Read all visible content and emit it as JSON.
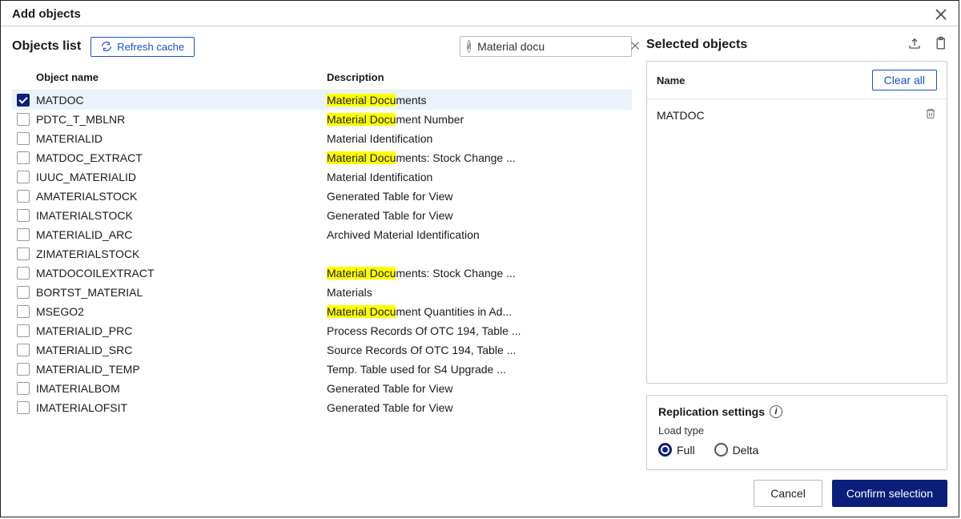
{
  "dialog": {
    "title": "Add objects"
  },
  "left": {
    "heading": "Objects list",
    "refresh_label": "Refresh cache",
    "search_value": "Material docu",
    "columns": {
      "object": "Object name",
      "description": "Description"
    },
    "highlight_prefix": "Material Docu",
    "rows": [
      {
        "name": "MATDOC",
        "checked": true,
        "desc_prefix": "Material Docu",
        "desc_rest": "ments"
      },
      {
        "name": "PDTC_T_MBLNR",
        "checked": false,
        "desc_prefix": "Material Docu",
        "desc_rest": "ment Number"
      },
      {
        "name": "MATERIALID",
        "checked": false,
        "desc_prefix": "",
        "desc_rest": "Material Identification"
      },
      {
        "name": "MATDOC_EXTRACT",
        "checked": false,
        "desc_prefix": "Material Docu",
        "desc_rest": "ments: Stock Change ..."
      },
      {
        "name": "IUUC_MATERIALID",
        "checked": false,
        "desc_prefix": "",
        "desc_rest": "Material Identification"
      },
      {
        "name": "AMATERIALSTOCK",
        "checked": false,
        "desc_prefix": "",
        "desc_rest": "Generated Table for View"
      },
      {
        "name": "IMATERIALSTOCK",
        "checked": false,
        "desc_prefix": "",
        "desc_rest": "Generated Table for View"
      },
      {
        "name": "MATERIALID_ARC",
        "checked": false,
        "desc_prefix": "",
        "desc_rest": "Archived Material Identification"
      },
      {
        "name": "ZIMATERIALSTOCK",
        "checked": false,
        "desc_prefix": "",
        "desc_rest": ""
      },
      {
        "name": "MATDOCOILEXTRACT",
        "checked": false,
        "desc_prefix": "Material Docu",
        "desc_rest": "ments: Stock Change ..."
      },
      {
        "name": "BORTST_MATERIAL",
        "checked": false,
        "desc_prefix": "",
        "desc_rest": "Materials"
      },
      {
        "name": "MSEGO2",
        "checked": false,
        "desc_prefix": "Material Docu",
        "desc_rest": "ment Quantities in Ad..."
      },
      {
        "name": "MATERIALID_PRC",
        "checked": false,
        "desc_prefix": "",
        "desc_rest": "Process Records Of OTC 194, Table ..."
      },
      {
        "name": "MATERIALID_SRC",
        "checked": false,
        "desc_prefix": "",
        "desc_rest": "Source Records Of OTC 194, Table ..."
      },
      {
        "name": "MATERIALID_TEMP",
        "checked": false,
        "desc_prefix": "",
        "desc_rest": "Temp. Table used for S4 Upgrade ..."
      },
      {
        "name": "IMATERIALBOM",
        "checked": false,
        "desc_prefix": "",
        "desc_rest": "Generated Table for View"
      },
      {
        "name": "IMATERIALOFSIT",
        "checked": false,
        "desc_prefix": "",
        "desc_rest": "Generated Table for View"
      }
    ]
  },
  "right": {
    "heading": "Selected objects",
    "name_label": "Name",
    "clear_all_label": "Clear all",
    "selected": [
      {
        "name": "MATDOC"
      }
    ],
    "replication": {
      "title": "Replication settings",
      "load_type_label": "Load type",
      "options": {
        "full": "Full",
        "delta": "Delta"
      },
      "selected": "full"
    }
  },
  "footer": {
    "cancel": "Cancel",
    "confirm": "Confirm selection"
  }
}
